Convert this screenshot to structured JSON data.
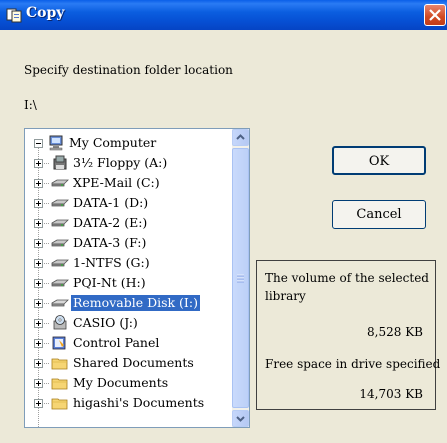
{
  "window": {
    "title": "Copy",
    "close_icon": "close-icon"
  },
  "prompt": "Specify destination folder location",
  "current_path": "I:\\",
  "tree": {
    "root": "My Computer",
    "items": [
      {
        "label": "3½ Floppy (A:)",
        "icon": "floppy-icon"
      },
      {
        "label": "XPE-Mail (C:)",
        "icon": "hard-drive-icon"
      },
      {
        "label": "DATA-1 (D:)",
        "icon": "hard-drive-icon"
      },
      {
        "label": "DATA-2 (E:)",
        "icon": "hard-drive-icon"
      },
      {
        "label": "DATA-3 (F:)",
        "icon": "hard-drive-icon"
      },
      {
        "label": "1-NTFS (G:)",
        "icon": "hard-drive-icon"
      },
      {
        "label": "PQI-Nt (H:)",
        "icon": "hard-drive-icon"
      },
      {
        "label": "Removable Disk (I:)",
        "icon": "removable-disk-icon",
        "selected": true
      },
      {
        "label": "CASIO (J:)",
        "icon": "cd-drive-icon"
      },
      {
        "label": "Control Panel",
        "icon": "control-panel-icon"
      },
      {
        "label": "Shared Documents",
        "icon": "folder-icon"
      },
      {
        "label": "My Documents",
        "icon": "folder-icon"
      },
      {
        "label": "higashi's Documents",
        "icon": "folder-icon"
      }
    ]
  },
  "buttons": {
    "ok": "OK",
    "cancel": "Cancel"
  },
  "info": {
    "volume_label_1": "The volume of the selected",
    "volume_label_2": "library",
    "volume_value": "8,528  KB",
    "free_label": "Free space in drive specified",
    "free_value": "14,703  KB"
  },
  "colors": {
    "titlebar": "#0b5ee0",
    "selection": "#316ac5",
    "close": "#d04a22"
  }
}
